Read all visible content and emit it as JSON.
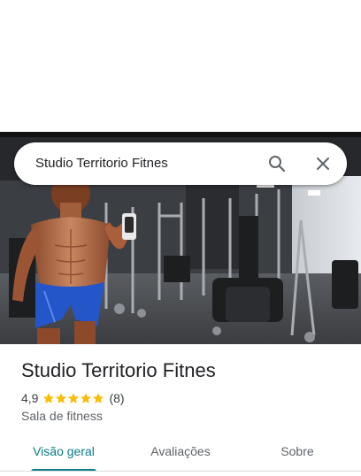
{
  "search": {
    "query": "Studio Territorio Fitnes",
    "search_icon": "search-icon",
    "clear_icon": "close-icon"
  },
  "place": {
    "title": "Studio Territorio Fitnes",
    "rating": "4,9",
    "rating_stars": 5,
    "review_count": "(8)",
    "category": "Sala de fitness"
  },
  "tabs": [
    {
      "label": "Visão geral",
      "active": true
    },
    {
      "label": "Avaliações",
      "active": false
    },
    {
      "label": "Sobre",
      "active": false
    }
  ],
  "colors": {
    "accent": "#0b7c8a",
    "star": "#fbbc04"
  }
}
